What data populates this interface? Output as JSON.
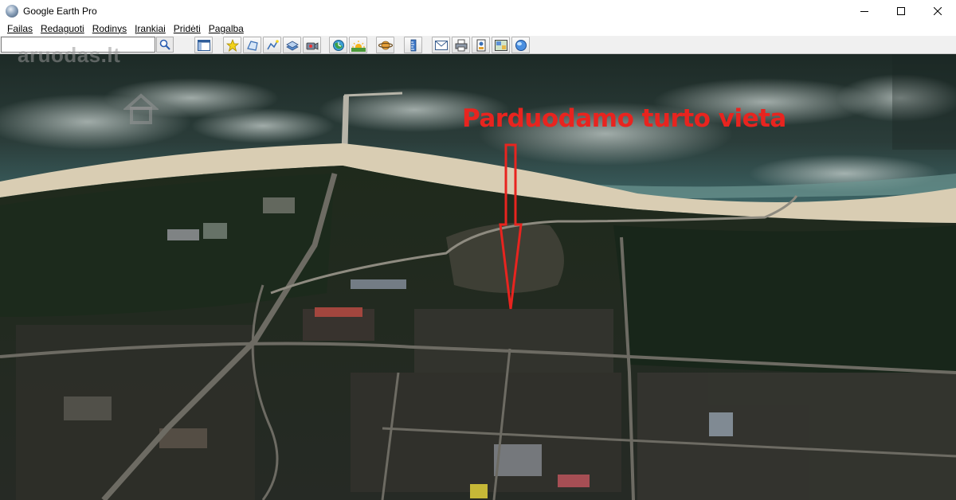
{
  "window": {
    "title": "Google Earth Pro",
    "controls": [
      "minimize-icon",
      "maximize-icon",
      "close-icon"
    ]
  },
  "menu": {
    "items": [
      "Failas",
      "Redaguoti",
      "Rodinys",
      "Įrankiai",
      "Pridėti",
      "Pagalba"
    ]
  },
  "search": {
    "value": "",
    "placeholder": "",
    "button_icon": "magnifier-icon"
  },
  "toolbar": {
    "icons": [
      "sidebar-toggle-icon",
      "add-placemark-icon",
      "add-polygon-icon",
      "add-path-icon",
      "add-image-overlay-icon",
      "record-tour-icon",
      "historical-imagery-icon",
      "sunlight-icon",
      "planets-icon",
      "ruler-icon",
      "email-icon",
      "print-icon",
      "save-image-icon",
      "view-in-maps-icon",
      "web-globe-icon"
    ]
  },
  "map": {
    "watermark": "aruodas.lt",
    "annotation": "Parduodamo turto vieta",
    "annotation_color": "#e8241f",
    "annotation_pointer": "down-arrow"
  }
}
